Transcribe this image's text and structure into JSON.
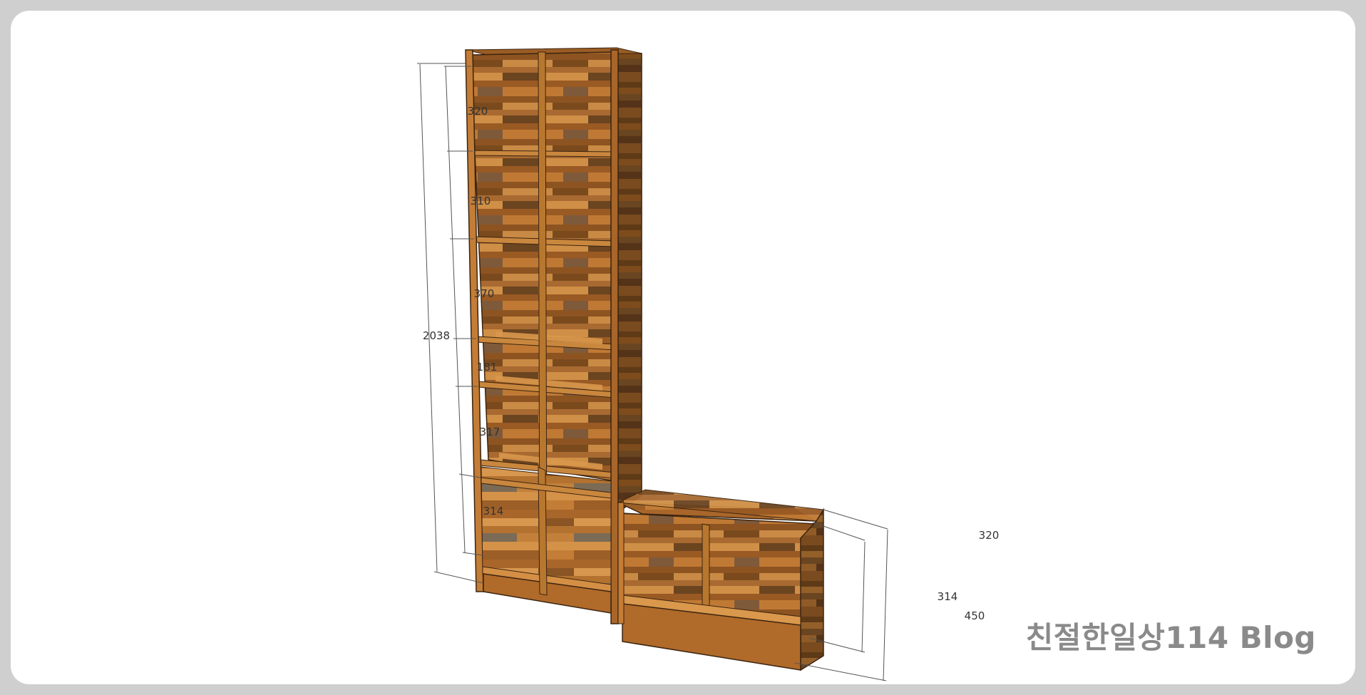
{
  "dimensions": {
    "total_height": "2038",
    "tall_unit": [
      "320",
      "310",
      "370",
      "181",
      "317",
      "314"
    ],
    "bench_depth": "320",
    "bench_inner": "314",
    "bench_height": "450"
  },
  "watermark": "친절한일상114 Blog",
  "colors": {
    "background": "#cfcfcf",
    "card": "#ffffff",
    "wood_light": "#c8843a",
    "wood_mid": "#a65f22",
    "wood_dark": "#6e4316",
    "dimension_line": "#555555",
    "watermark": "#8a8a8a"
  }
}
